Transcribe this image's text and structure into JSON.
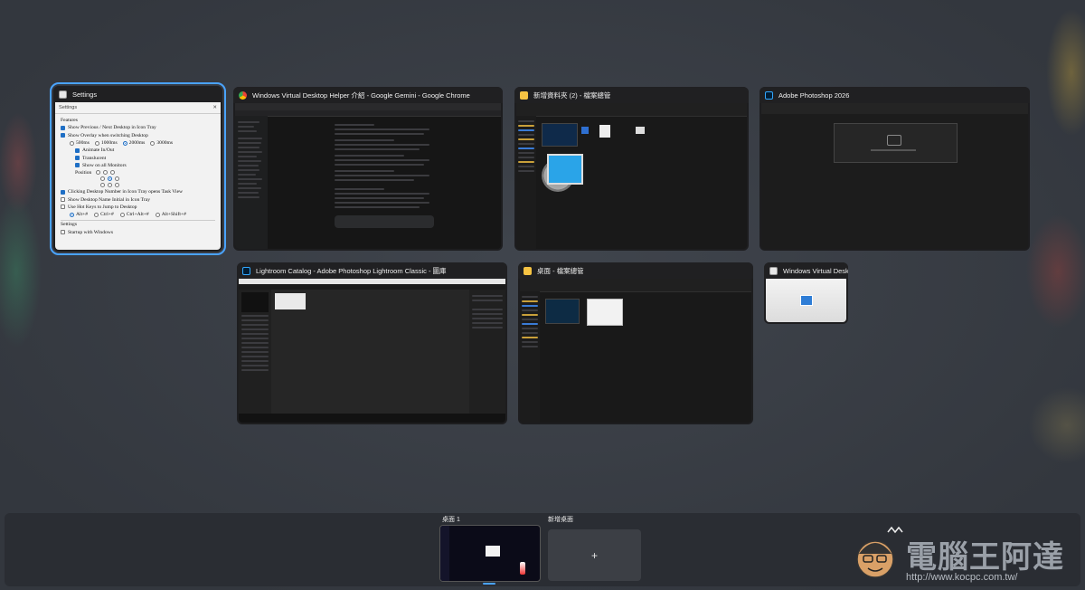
{
  "windows": {
    "settings": {
      "title": "Settings",
      "inner_title": "Settings",
      "features_heading": "Features",
      "items": [
        {
          "label": "Show Previous / Next Desktop in Icon Tray",
          "checked": true
        },
        {
          "label": "Show Overlay when switching Desktop",
          "checked": true
        }
      ],
      "durations": [
        "500ms",
        "1000ms",
        "2000ms",
        "3000ms"
      ],
      "selected_duration": "2000ms",
      "sub_items": [
        {
          "label": "Animate In/Out",
          "checked": true
        },
        {
          "label": "Translucent",
          "checked": true
        },
        {
          "label": "Show on all Monitors",
          "checked": true
        }
      ],
      "position_label": "Position",
      "more_items": [
        {
          "label": "Clicking Desktop Number in Icon Tray opens Task View",
          "checked": true
        },
        {
          "label": "Show Desktop Name Initial in Icon Tray",
          "checked": false
        },
        {
          "label": "Use Hot Keys to Jump to Desktop",
          "checked": false
        }
      ],
      "hotkeys": [
        "Alt+#",
        "Ctrl+#",
        "Ctrl+Alt+#",
        "Alt+Shift+#"
      ],
      "settings_heading": "Settings",
      "startup_label": "Startup with Windows"
    },
    "chrome": {
      "title": "Windows Virtual Desktop Helper 介紹 - Google Gemini - Google Chrome"
    },
    "explorer1": {
      "title": "新增資料夾 (2) - 檔案總管"
    },
    "photoshop": {
      "title": "Adobe Photoshop 2026"
    },
    "lightroom": {
      "title": "Lightroom Catalog - Adobe Photoshop Lightroom Classic - 圖庫"
    },
    "explorer2": {
      "title": "桌面 - 檔案總管"
    },
    "helper": {
      "title": "Windows Virtual Deskto..."
    }
  },
  "desktops": {
    "current_label": "桌面 1",
    "new_label": "新增桌面",
    "plus": "+"
  },
  "watermark": {
    "name": "電腦王阿達",
    "url": "http://www.kocpc.com.tw/"
  },
  "colors": {
    "focus": "#4aa3ff",
    "chrome": "#4285f4",
    "photoshop": "#31a8ff",
    "lightroom": "#31a8ff",
    "folder": "#f6c343"
  }
}
